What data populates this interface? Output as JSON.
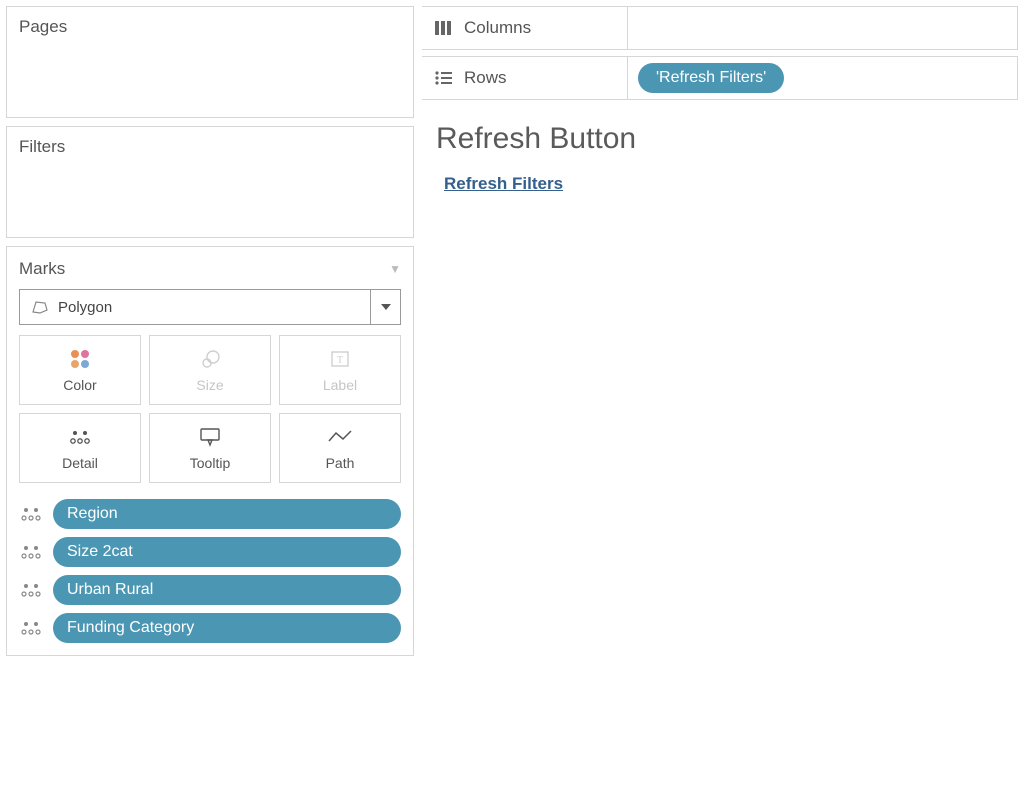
{
  "left": {
    "pages_label": "Pages",
    "filters_label": "Filters",
    "marks_label": "Marks",
    "mark_type": "Polygon",
    "mark_cards": {
      "color": "Color",
      "size": "Size",
      "label": "Label",
      "detail": "Detail",
      "tooltip": "Tooltip",
      "path": "Path"
    },
    "detail_pills": [
      "Region",
      "Size 2cat",
      "Urban Rural",
      "Funding Category"
    ]
  },
  "shelves": {
    "columns_label": "Columns",
    "rows_label": "Rows",
    "rows_pills": [
      "'Refresh Filters'"
    ]
  },
  "viz": {
    "title": "Refresh Button",
    "link_text": "Refresh Filters"
  }
}
